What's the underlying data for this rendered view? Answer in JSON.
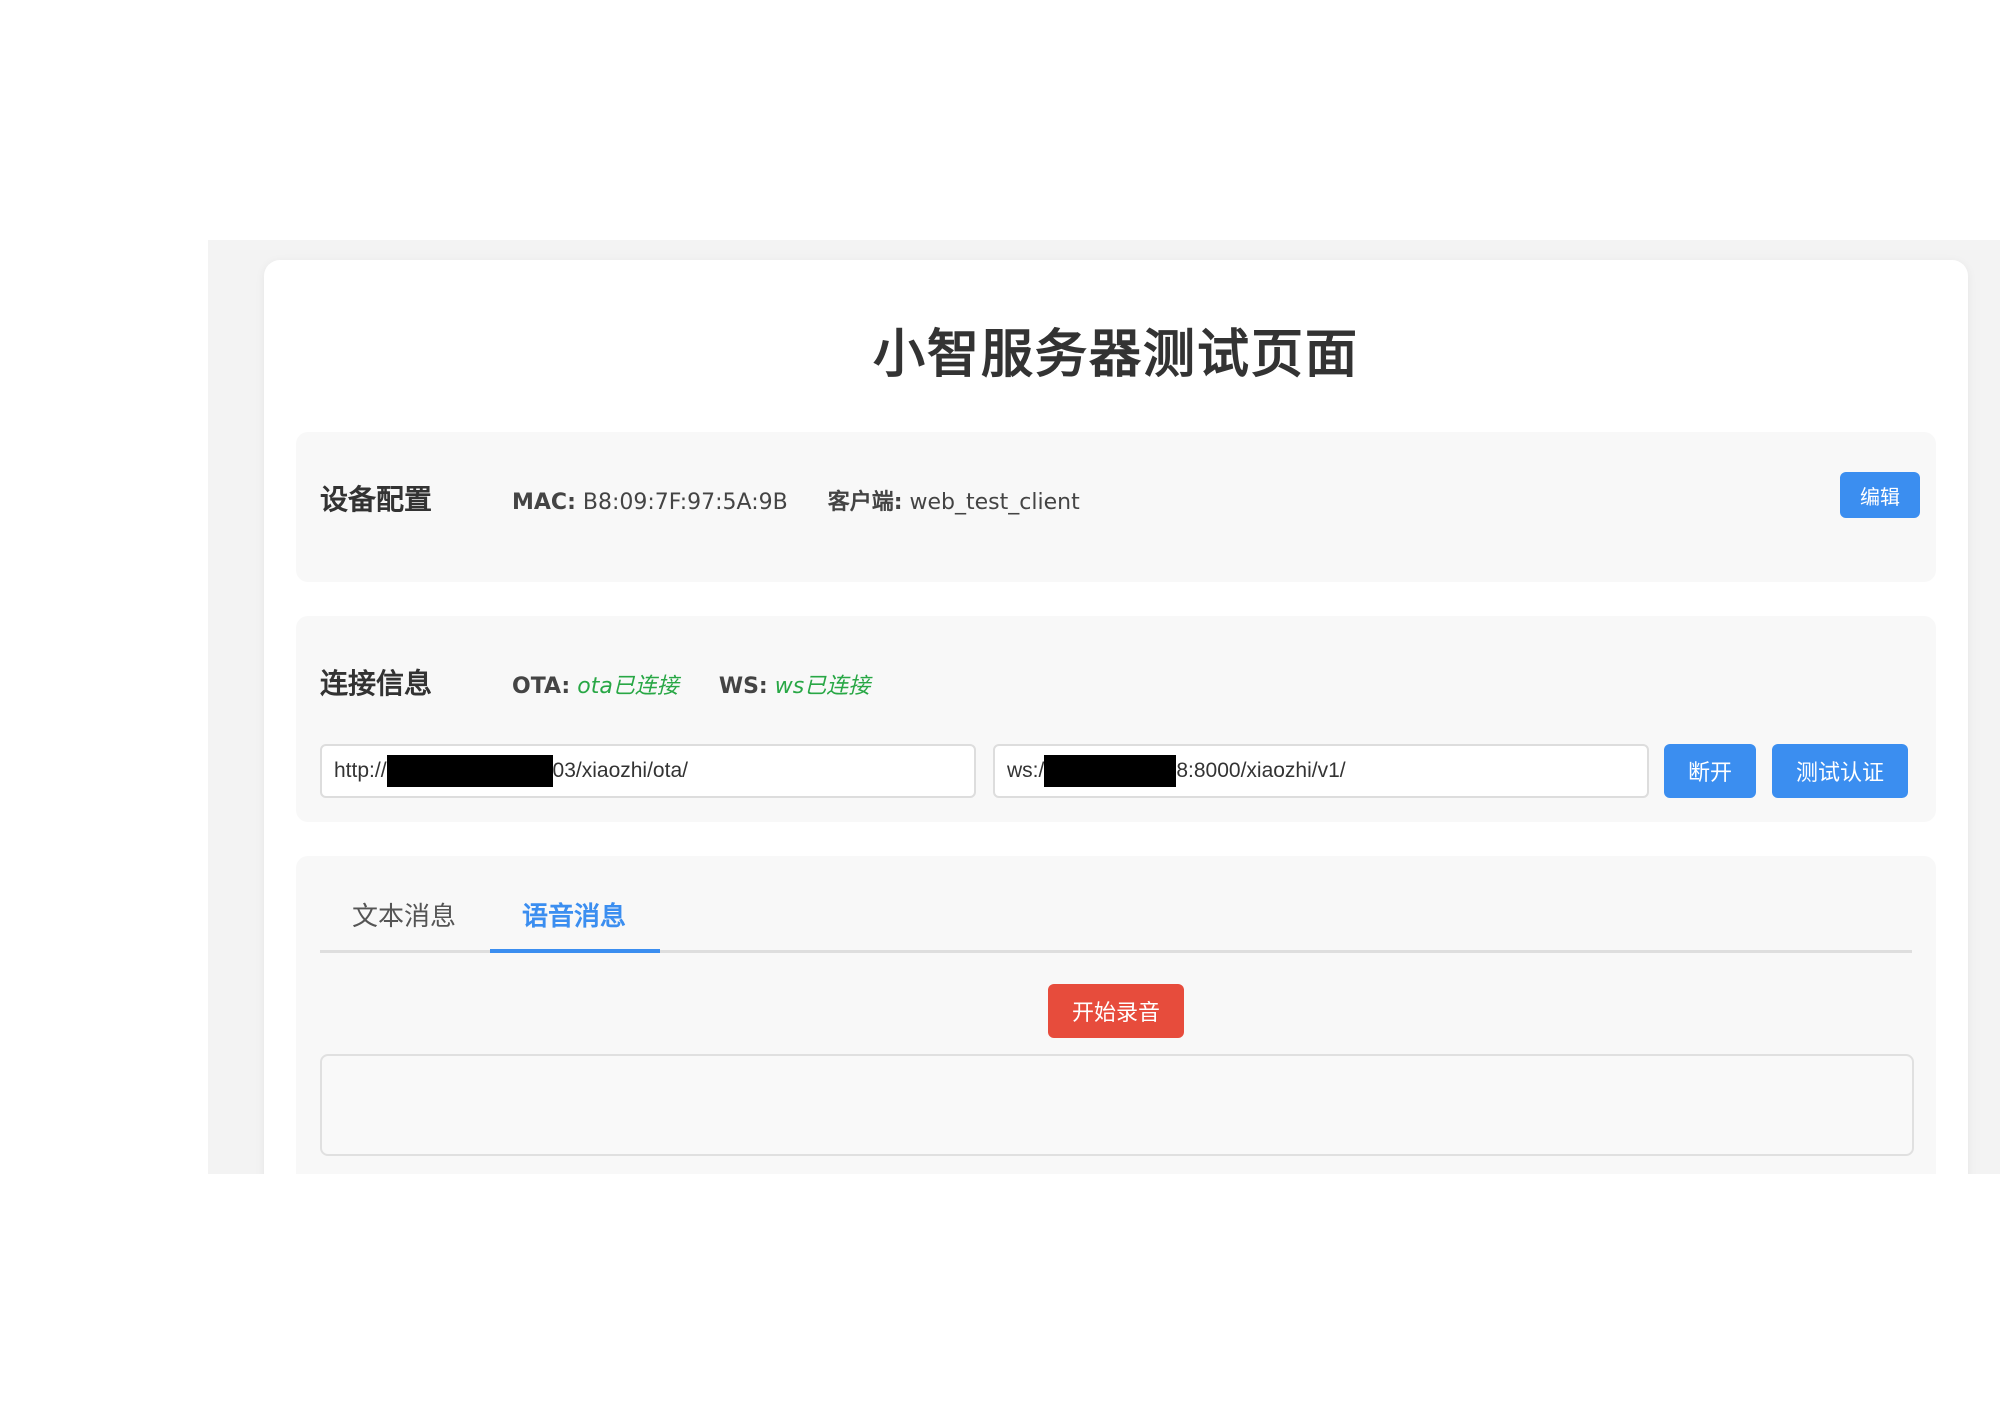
{
  "page": {
    "title": "小智服务器测试页面"
  },
  "device_config": {
    "title": "设备配置",
    "mac_label": "MAC:",
    "mac_value": "B8:09:7F:97:5A:9B",
    "client_label": "客户端:",
    "client_value": "web_test_client",
    "edit_button": "编辑"
  },
  "connection": {
    "title": "连接信息",
    "ota_label": "OTA:",
    "ota_status": "ota已连接",
    "ws_label": "WS:",
    "ws_status": "ws已连接",
    "ota_url_prefix": "http://",
    "ota_url_suffix": "03/xiaozhi/ota/",
    "ws_url_prefix": "ws:/",
    "ws_url_suffix": "8:8000/xiaozhi/v1/",
    "disconnect_button": "断开",
    "test_auth_button": "测试认证"
  },
  "messages": {
    "tabs": [
      {
        "label": "文本消息",
        "active": false
      },
      {
        "label": "语音消息",
        "active": true
      }
    ],
    "record_button": "开始录音"
  },
  "colors": {
    "accent": "#3b8ef0",
    "danger": "#e74c3c",
    "success": "#28a745"
  }
}
